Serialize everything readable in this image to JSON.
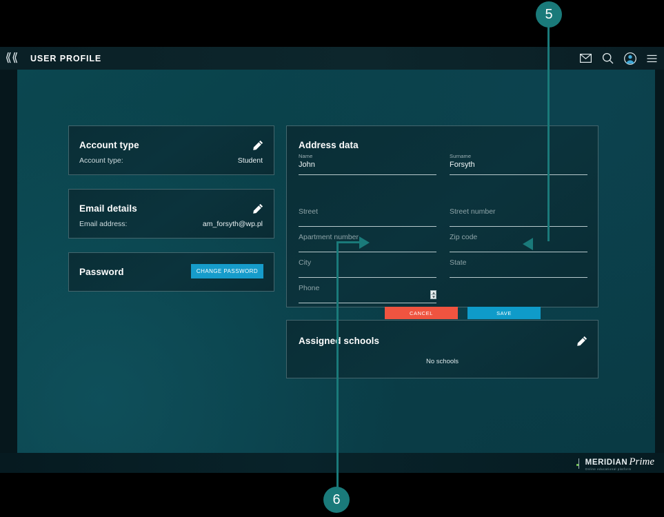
{
  "topbar": {
    "collapse_icon": "chevron-double-left-icon",
    "title": "USER PROFILE",
    "icons": [
      {
        "name": "mail-icon",
        "glyph": "envelope"
      },
      {
        "name": "search-icon",
        "glyph": "magnifier"
      },
      {
        "name": "account-avatar-icon",
        "glyph": "avatar"
      },
      {
        "name": "menu-icon",
        "glyph": "hamburger"
      }
    ]
  },
  "account_panel": {
    "title": "Account type",
    "row_label": "Account type:",
    "row_value": "Student",
    "edit_icon": "pencil-icon"
  },
  "email_panel": {
    "title": "Email details",
    "row_label": "Email address:",
    "row_value": "am_forsyth@wp.pl",
    "edit_icon": "pencil-icon"
  },
  "password_panel": {
    "title": "Password",
    "change_button": "CHANGE PASSWORD"
  },
  "address_panel": {
    "title": "Address data",
    "fields": [
      {
        "label": "Name",
        "value": "John",
        "placeholder": "Name",
        "filled": true
      },
      {
        "label": "Surname",
        "value": "Forsyth",
        "placeholder": "Surname",
        "filled": true
      },
      {
        "label": "Street",
        "value": "",
        "placeholder": "Street",
        "filled": false
      },
      {
        "label": "Street number",
        "value": "",
        "placeholder": "Street number",
        "filled": false
      },
      {
        "label": "Apartment number",
        "value": "",
        "placeholder": "Apartment number",
        "filled": false
      },
      {
        "label": "Zip code",
        "value": "",
        "placeholder": "Zip code",
        "filled": false
      },
      {
        "label": "City",
        "value": "",
        "placeholder": "City",
        "filled": false
      },
      {
        "label": "State",
        "value": "",
        "placeholder": "State",
        "filled": false
      },
      {
        "label": "Phone",
        "value": "",
        "placeholder": "Phone",
        "filled": false
      }
    ],
    "cancel_button": "CANCEL",
    "save_button": "SAVE"
  },
  "schools_panel": {
    "title": "Assigned schools",
    "empty_text": "No schools",
    "edit_icon": "pencil-icon"
  },
  "footer": {
    "logo_name": "MERIDIAN",
    "logo_prime": "Prime",
    "logo_tagline": "Online educational platform"
  },
  "annotations": {
    "marker_5": "5",
    "marker_6": "6",
    "color": "#1a7a7a"
  },
  "colors": {
    "accent_blue": "#0f9bc9",
    "danger_red": "#ef5440",
    "panel_bg": "#0a3039",
    "canvas_bg": "#0a414a",
    "annotation_teal": "#1a7a7a"
  }
}
